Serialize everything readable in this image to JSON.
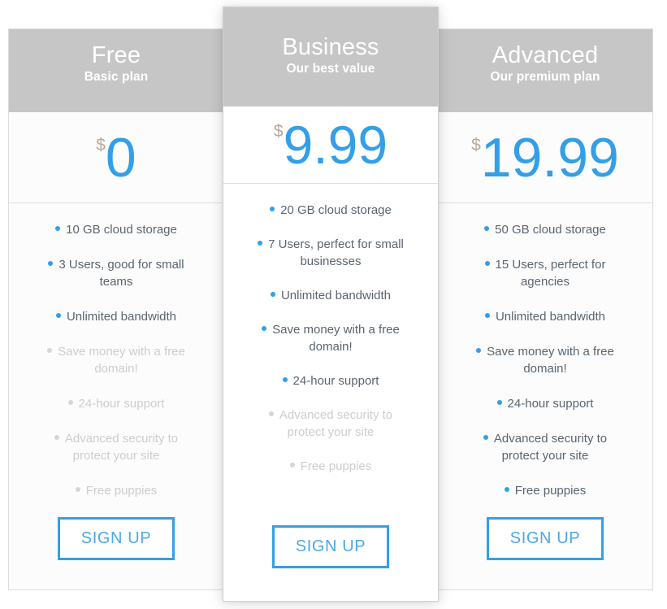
{
  "colors": {
    "accent": "#339FE8",
    "header_bg": "#C6C6C6",
    "text": "#5A6570",
    "muted": "#CDCDCD",
    "currency": "#B9A99B",
    "card_bg": "#FCFCFC",
    "featured_card_bg": "#FFFFFF"
  },
  "plans": [
    {
      "id": "free",
      "name": "Free",
      "subtitle": "Basic plan",
      "currency": "$",
      "price": "0",
      "cta": "SIGN UP",
      "featured": false,
      "features": [
        {
          "text": "10 GB cloud storage",
          "enabled": true
        },
        {
          "text": "3 Users, good for small teams",
          "enabled": true
        },
        {
          "text": "Unlimited bandwidth",
          "enabled": true
        },
        {
          "text": "Save money with a free domain!",
          "enabled": false
        },
        {
          "text": "24-hour support",
          "enabled": false
        },
        {
          "text": "Advanced security to protect your site",
          "enabled": false
        },
        {
          "text": "Free puppies",
          "enabled": false
        }
      ]
    },
    {
      "id": "business",
      "name": "Business",
      "subtitle": "Our best value",
      "currency": "$",
      "price": "9.99",
      "cta": "SIGN UP",
      "featured": true,
      "features": [
        {
          "text": "20 GB cloud storage",
          "enabled": true
        },
        {
          "text": "7 Users, perfect for small businesses",
          "enabled": true
        },
        {
          "text": "Unlimited bandwidth",
          "enabled": true
        },
        {
          "text": "Save money with a free domain!",
          "enabled": true
        },
        {
          "text": "24-hour support",
          "enabled": true
        },
        {
          "text": "Advanced security to protect your site",
          "enabled": false
        },
        {
          "text": "Free puppies",
          "enabled": false
        }
      ]
    },
    {
      "id": "advanced",
      "name": "Advanced",
      "subtitle": "Our premium plan",
      "currency": "$",
      "price": "19.99",
      "cta": "SIGN UP",
      "featured": false,
      "features": [
        {
          "text": "50 GB cloud storage",
          "enabled": true
        },
        {
          "text": "15 Users, perfect for agencies",
          "enabled": true
        },
        {
          "text": "Unlimited bandwidth",
          "enabled": true
        },
        {
          "text": "Save money with a free domain!",
          "enabled": true
        },
        {
          "text": "24-hour support",
          "enabled": true
        },
        {
          "text": "Advanced security to protect your site",
          "enabled": true
        },
        {
          "text": "Free puppies",
          "enabled": true
        }
      ]
    }
  ]
}
